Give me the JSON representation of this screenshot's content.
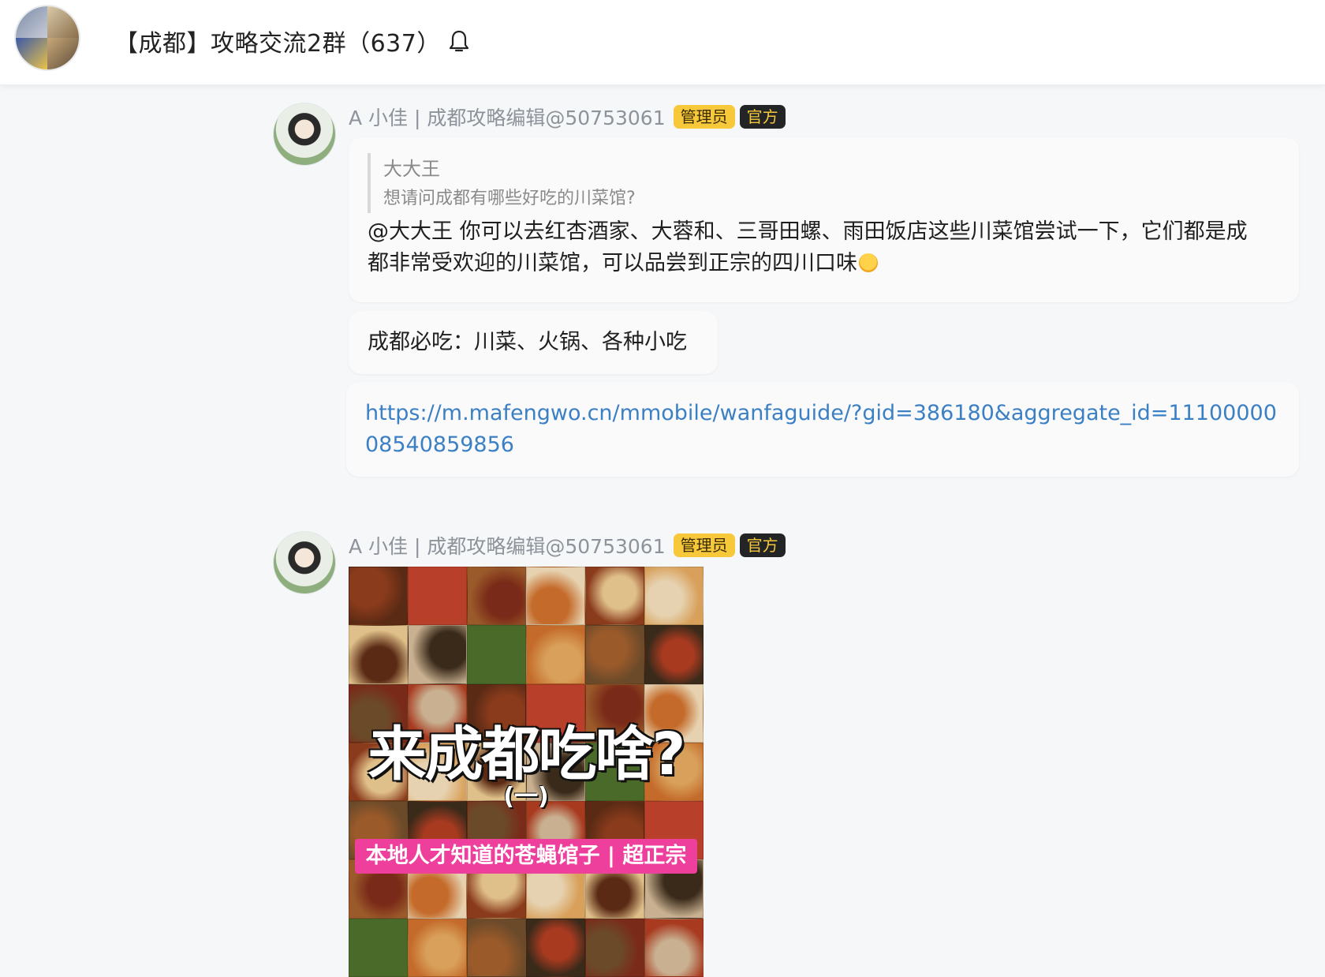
{
  "header": {
    "group_title": "【成都】攻略交流2群（637）",
    "bell_icon": "bell-icon",
    "group_avatar_icon": "group-avatar"
  },
  "messages": [
    {
      "sender": "A 小佳 | 成都攻略编辑@50753061",
      "badges": {
        "admin": "管理员",
        "official": "官方"
      },
      "quote": {
        "name": "大大王",
        "text": "想请问成都有哪些好吃的川菜馆?"
      },
      "reply": "@大大王  你可以去红杏酒家、大蓉和、三哥田螺、雨田饭店这些川菜馆尝试一下，它们都是成都非常受欢迎的川菜馆，可以品尝到正宗的四川口味",
      "emoji": "smiling-face-emoji",
      "second": "成都必吃：川菜、火锅、各种小吃",
      "link": "https://m.mafengwo.cn/mmobile/wanfaguide/?gid=386180&aggregate_id=1110000008540859856"
    },
    {
      "sender": "A 小佳 | 成都攻略编辑@50753061",
      "badges": {
        "admin": "管理员",
        "official": "官方"
      },
      "poster": {
        "title": "来成都吃啥?",
        "subtitle": "(一)",
        "banner": "本地人才知道的苍蝇馆子 | 超正宗"
      }
    }
  ],
  "colors": {
    "background": "#f5f7f9",
    "admin_badge": "#f7c83a",
    "official_badge": "#222426",
    "link": "#3b7fc4",
    "poster_banner": "#ee3f9c"
  }
}
